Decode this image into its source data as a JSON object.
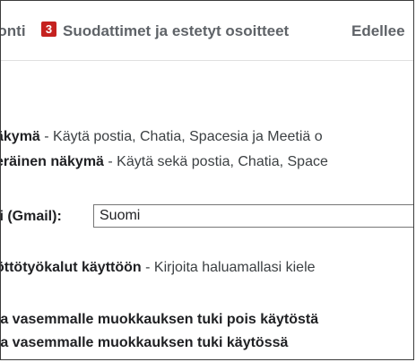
{
  "tabs": {
    "partial_tab_label": "uonti",
    "badge_number": "3",
    "filters_tab_label": "Suodattimet ja estetyt osoitteet",
    "next_tab_label": "Edellee"
  },
  "view_options": {
    "option1_title": "äkymä",
    "option1_desc": " - Käytä postia, Chatia, Spacesia ja Meetiä o",
    "option2_title": "eräinen näkymä",
    "option2_desc": " - Käytä sekä postia, Chatia, Space"
  },
  "language": {
    "label": "li (Gmail):",
    "selected": "Suomi"
  },
  "input_tools": {
    "title": "öttötyökalut käyttöön",
    "desc": " - Kirjoita haluamallasi kiele"
  },
  "rtl_editing": {
    "option_off": "ta vasemmalle muokkauksen tuki pois käytöstä",
    "option_on": "ta vasemmalle muokkauksen tuki käytössä"
  }
}
